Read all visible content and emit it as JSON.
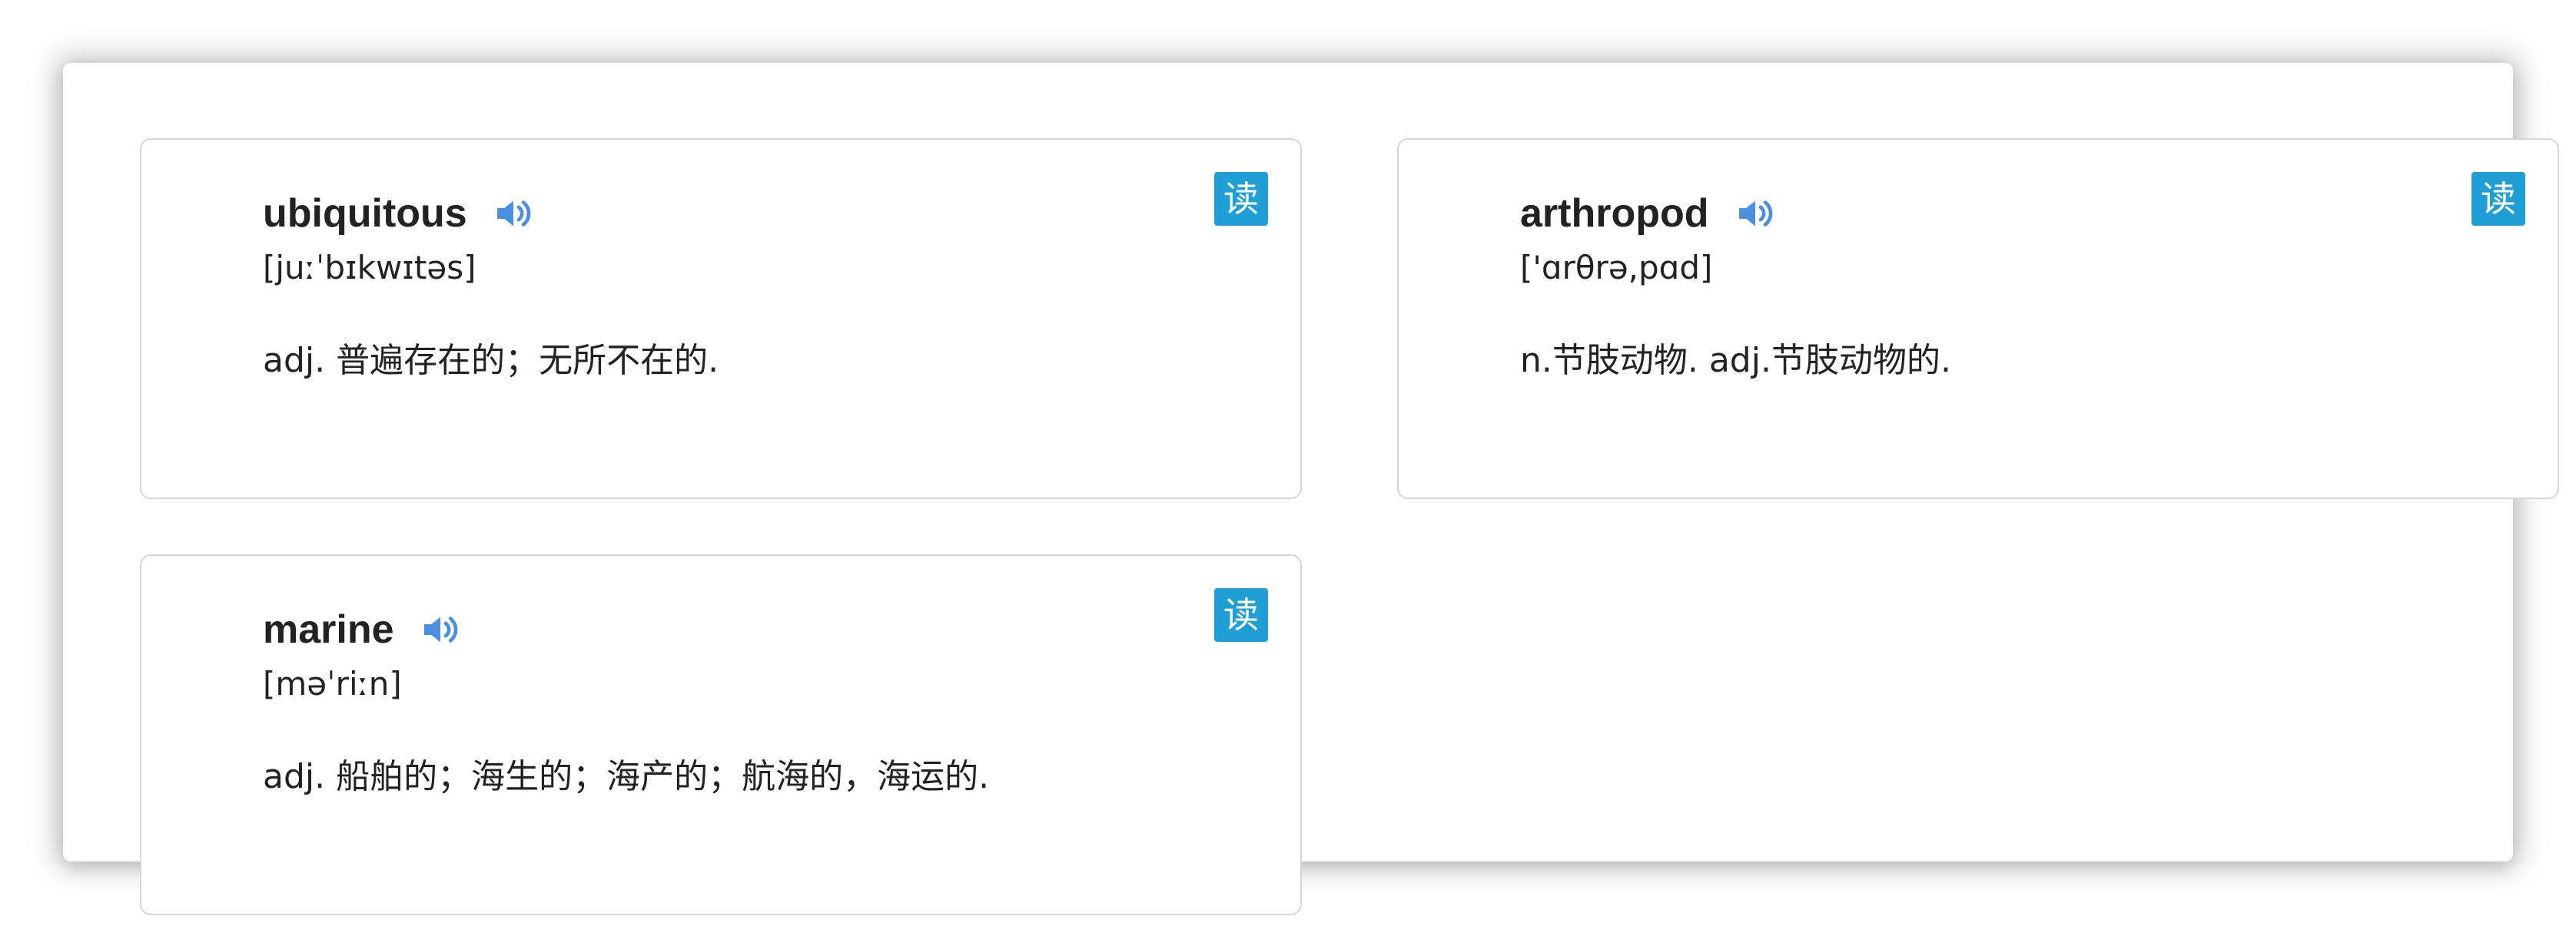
{
  "accent_color": "#1f9fd6",
  "speaker_icon_color": "#4a90e2",
  "cards": [
    {
      "word": "ubiquitous",
      "phonetic": "[juːˈbɪkwɪtəs]",
      "definition": "adj. 普遍存在的；无所不在的.",
      "read_label": "读",
      "speaker_icon": "speaker-icon"
    },
    {
      "word": "arthropod",
      "phonetic": "['ɑrθrə,pɑd]",
      "definition": "n.节肢动物. adj.节肢动物的.",
      "read_label": "读",
      "speaker_icon": "speaker-icon"
    },
    {
      "word": "marine",
      "phonetic": "[məˈriːn]",
      "definition": "adj. 船舶的；海生的；海产的；航海的，海运的.",
      "read_label": "读",
      "speaker_icon": "speaker-icon"
    }
  ]
}
